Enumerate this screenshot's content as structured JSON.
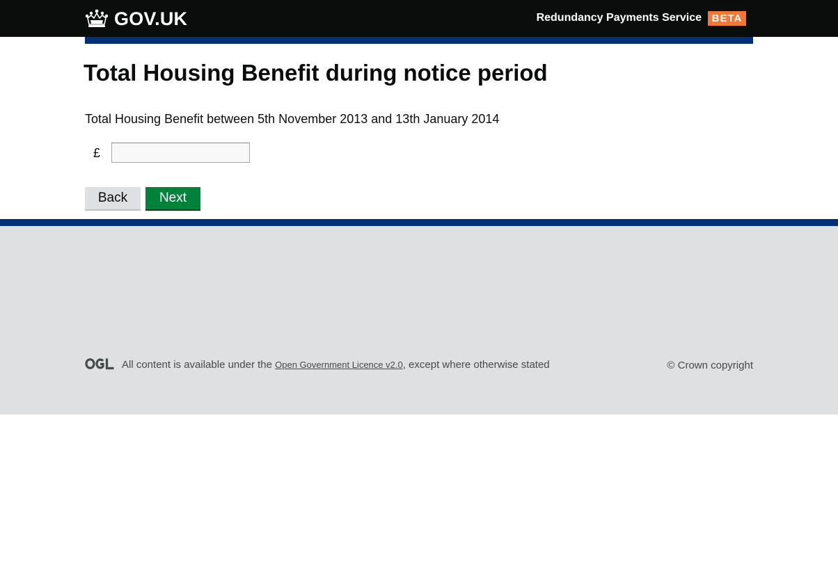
{
  "header": {
    "logo_text": "GOV.UK",
    "service_name": "Redundancy Payments Service",
    "phase_tag": "BETA"
  },
  "main": {
    "title": "Total Housing Benefit during notice period",
    "question": "Total Housing Benefit between 5th November 2013 and 13th January 2014",
    "currency_symbol": "£",
    "amount_value": "",
    "back_label": "Back",
    "next_label": "Next"
  },
  "footer": {
    "licence_prefix": "All content is available under the ",
    "licence_link": "Open Government Licence v2.0",
    "licence_suffix": ", except where otherwise stated",
    "copyright": "© Crown copyright"
  },
  "colors": {
    "header_bg": "#0b0c0c",
    "brand_blue": "#003078",
    "beta_orange": "#f47738",
    "next_green": "#00823b",
    "footer_bg": "#dee0e2"
  },
  "icons": {
    "logo": "crown-icon",
    "licence": "ogl-icon"
  }
}
